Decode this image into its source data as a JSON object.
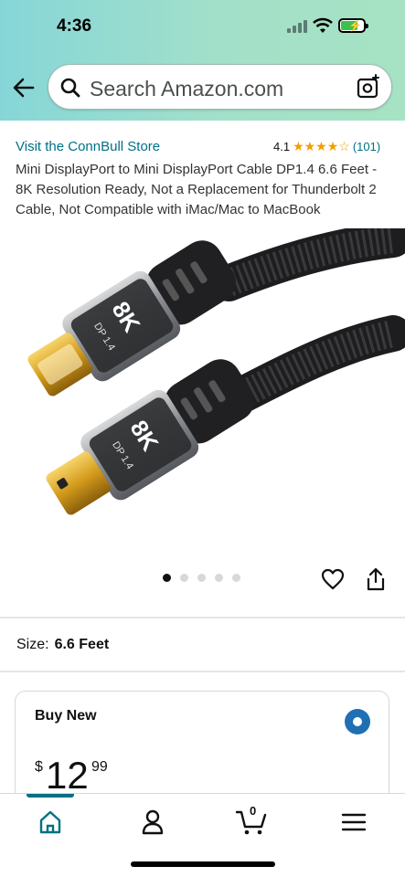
{
  "status_bar": {
    "time": "4:36"
  },
  "search": {
    "placeholder": "Search Amazon.com"
  },
  "product": {
    "store_link": "Visit the ConnBull Store",
    "rating": "4.1",
    "stars": "★★★★☆",
    "rating_count": "(101)",
    "title": "Mini DisplayPort to Mini DisplayPort Cable DP1.4 6.6 Feet - 8K Resolution Ready, Not a Replacement for Thunderbolt 2 Cable, Not Compatible with iMac/Mac to MacBook",
    "image_label_primary": "8K",
    "image_label_secondary": "DP 1.4",
    "image_dots": 5,
    "image_dot_active": 0
  },
  "size": {
    "label": "Size:",
    "value": "6.6 Feet"
  },
  "buy_box": {
    "label": "Buy New",
    "price_symbol": "$",
    "price_whole": "12",
    "price_fraction": "99"
  },
  "tab_bar": {
    "items": [
      "home-icon",
      "account-icon",
      "cart-icon",
      "menu-icon"
    ],
    "cart_count": "0",
    "active": "home"
  },
  "colors": {
    "link": "#007185",
    "stars": "#f19e00",
    "radio": "#1f6fb4",
    "header_gradient_start": "#86d6d8",
    "header_gradient_end": "#a6e2c3"
  }
}
